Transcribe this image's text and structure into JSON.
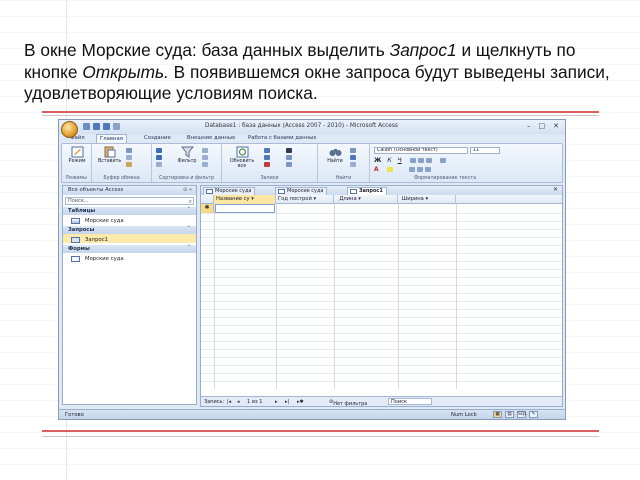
{
  "caption": {
    "part1": "В окне Морские суда: база данных выделить ",
    "query_name": "Запрос1",
    "part2": " и щелкнуть по кнопке ",
    "button_name": "Открыть.",
    "part3": " В появившемся окне запроса будут выведены записи, удовлетворяющие условиям поиска."
  },
  "window": {
    "title": "Database1 : база данных (Access 2007 - 2010) - Microsoft Access",
    "controls": [
      "–",
      "□",
      "✕"
    ]
  },
  "ribbon": {
    "tabs": [
      "Файл",
      "Главная",
      "Создание",
      "Внешние данные",
      "Работа с базами данных"
    ],
    "active_tab_index": 1,
    "groups": [
      {
        "label": "Режимы",
        "buttons": [
          "Режим"
        ]
      },
      {
        "label": "Буфер обмена",
        "buttons": [
          "Вставить"
        ]
      },
      {
        "label": "Сортировка и фильтр",
        "buttons": [
          "Фильтр"
        ]
      },
      {
        "label": "Записи",
        "buttons": [
          "Обновить все"
        ]
      },
      {
        "label": "Найти",
        "buttons": [
          "Найти"
        ]
      },
      {
        "label": "Форматирование текста",
        "buttons": []
      }
    ],
    "font_name": "Calibri (Основной текст)",
    "font_size": "11"
  },
  "nav_pane": {
    "header": "Все объекты Access",
    "search_placeholder": "Поиск...",
    "sections": [
      {
        "title": "Таблицы",
        "items": [
          "Морские суда"
        ]
      },
      {
        "title": "Запросы",
        "items": [
          "Запрос1"
        ]
      },
      {
        "title": "Формы",
        "items": [
          "Морские суда"
        ]
      }
    ]
  },
  "document": {
    "tabs": [
      "Морские суда",
      "Морские суда",
      "Запрос1"
    ],
    "active_tab_index": 2,
    "columns": [
      "Название су",
      "Год построй",
      "Длина",
      "Ширина"
    ],
    "record_nav": {
      "label": "Запись:",
      "position": "1 из 1",
      "filter": "Нет фильтра",
      "search": "Поиск"
    }
  },
  "status_bar": {
    "left": "Готово",
    "num_lock": "Num Lock",
    "views": [
      "▦",
      "▤",
      "SQL",
      "✎"
    ]
  }
}
